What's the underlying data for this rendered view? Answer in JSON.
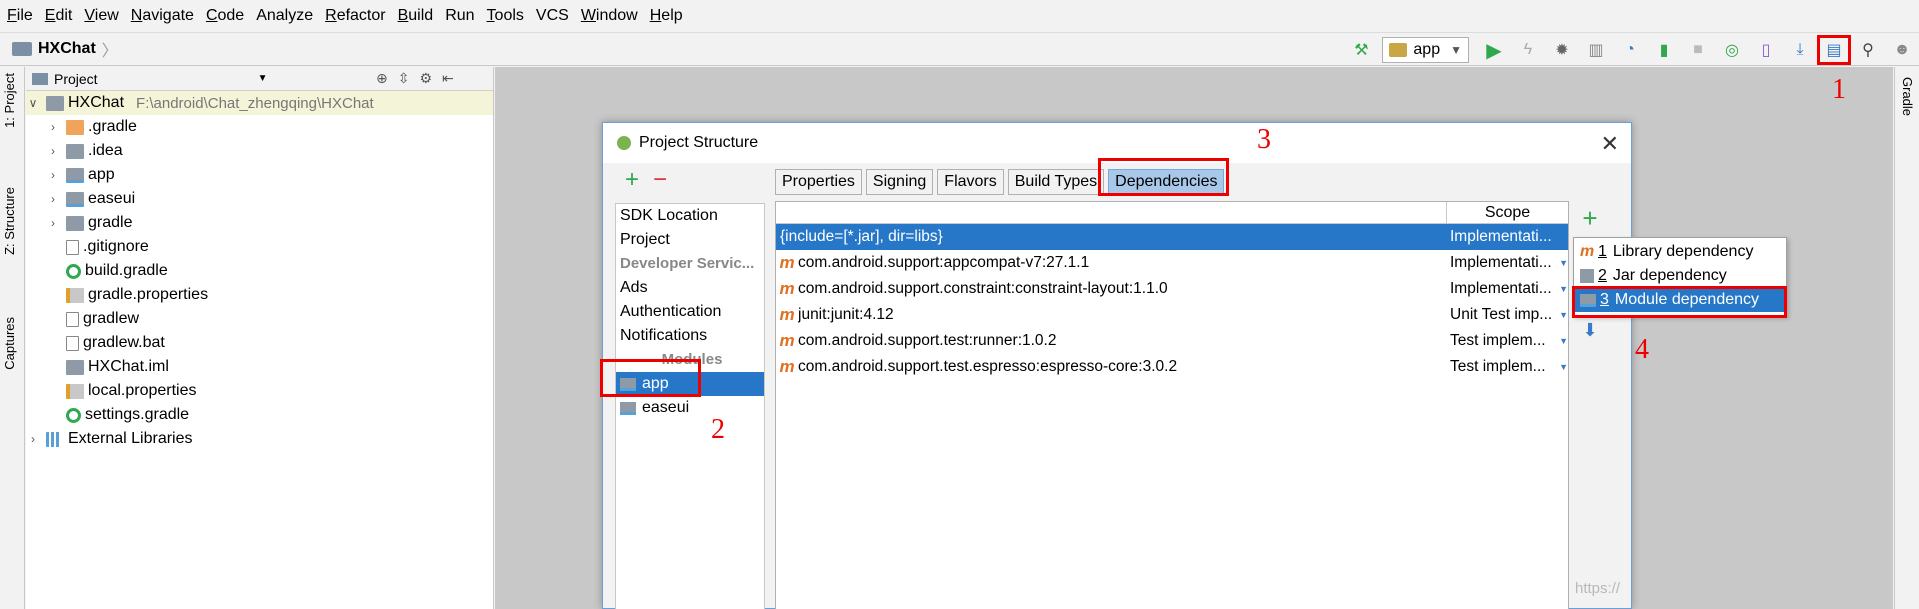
{
  "menu": [
    {
      "mn": "F",
      "rest": "ile"
    },
    {
      "mn": "E",
      "rest": "dit"
    },
    {
      "mn": "V",
      "rest": "iew"
    },
    {
      "mn": "N",
      "rest": "avigate"
    },
    {
      "mn": "C",
      "rest": "ode"
    },
    {
      "mn": "",
      "rest": "Analyze"
    },
    {
      "mn": "R",
      "rest": "efactor"
    },
    {
      "mn": "B",
      "rest": "uild"
    },
    {
      "mn": "",
      "rest": "Run"
    },
    {
      "mn": "T",
      "rest": "ools"
    },
    {
      "mn": "",
      "rest": "VCS"
    },
    {
      "mn": "W",
      "rest": "indow"
    },
    {
      "mn": "H",
      "rest": "elp"
    }
  ],
  "navbar": {
    "project": "HXChat",
    "run_config": "app"
  },
  "left_stripe": {
    "project_tab": "1: Project",
    "structure_tab": "Z: Structure",
    "captures_tab": "Captures"
  },
  "right_stripe": {
    "gradle_tab": "Gradle"
  },
  "project_panel": {
    "view_label": "Project",
    "root": {
      "name": "HXChat",
      "path": "F:\\android\\Chat_zhengqing\\HXChat"
    },
    "items": [
      {
        "label": ".gradle",
        "icon": "folder-orange",
        "expandable": true
      },
      {
        "label": ".idea",
        "icon": "folder-grey",
        "expandable": true
      },
      {
        "label": "app",
        "icon": "module",
        "expandable": true
      },
      {
        "label": "easeui",
        "icon": "module",
        "expandable": true
      },
      {
        "label": "gradle",
        "icon": "folder-grey",
        "expandable": true
      },
      {
        "label": ".gitignore",
        "icon": "file",
        "expandable": false
      },
      {
        "label": "build.gradle",
        "icon": "gradle",
        "expandable": false
      },
      {
        "label": "gradle.properties",
        "icon": "props",
        "expandable": false
      },
      {
        "label": "gradlew",
        "icon": "file",
        "expandable": false
      },
      {
        "label": "gradlew.bat",
        "icon": "file",
        "expandable": false
      },
      {
        "label": "HXChat.iml",
        "icon": "iml",
        "expandable": false
      },
      {
        "label": "local.properties",
        "icon": "props",
        "expandable": false
      },
      {
        "label": "settings.gradle",
        "icon": "gradle",
        "expandable": false
      }
    ],
    "external": "External Libraries"
  },
  "dialog": {
    "title": "Project Structure",
    "left_items": [
      "SDK Location",
      "Project"
    ],
    "dev_services_header": "Developer Servic...",
    "service_items": [
      "Ads",
      "Authentication",
      "Notifications"
    ],
    "modules_header": "Modules",
    "modules": [
      "app",
      "easeui"
    ],
    "tabs": [
      "Properties",
      "Signing",
      "Flavors",
      "Build Types",
      "Dependencies"
    ],
    "active_tab": "Dependencies",
    "scope_header": "Scope",
    "dependencies": [
      {
        "name": "{include=[*.jar], dir=libs}",
        "scope": "Implementati...",
        "maven": false,
        "selected": true
      },
      {
        "name": "com.android.support:appcompat-v7:27.1.1",
        "scope": "Implementati...",
        "maven": true,
        "selected": false
      },
      {
        "name": "com.android.support.constraint:constraint-layout:1.1.0",
        "scope": "Implementati...",
        "maven": true,
        "selected": false
      },
      {
        "name": "junit:junit:4.12",
        "scope": "Unit Test imp...",
        "maven": true,
        "selected": false
      },
      {
        "name": "com.android.support.test:runner:1.0.2",
        "scope": "Test implem...",
        "maven": true,
        "selected": false
      },
      {
        "name": "com.android.support.test.espresso:espresso-core:3.0.2",
        "scope": "Test implem...",
        "maven": true,
        "selected": false
      }
    ],
    "maven_glyph": "m"
  },
  "popup": {
    "items": [
      {
        "num": "1",
        "label": "Library dependency"
      },
      {
        "num": "2",
        "label": "Jar dependency"
      },
      {
        "num": "3",
        "label": "Module dependency"
      }
    ]
  },
  "annotations": [
    "1",
    "2",
    "3",
    "4"
  ],
  "watermark": "https://"
}
